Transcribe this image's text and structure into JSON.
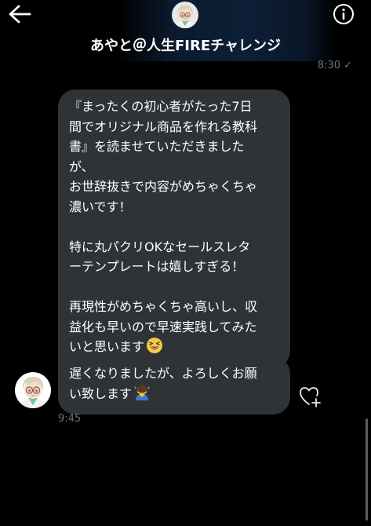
{
  "header": {
    "title": "あやと＠人生FIREチャレンジ",
    "back_icon": "arrow-left-icon",
    "info_icon": "info-icon"
  },
  "conversation": {
    "previous_time": "8:30 ✓",
    "messages": [
      {
        "lines": [
          "『まったくの初心者がたった7日",
          "間でオリジナル商品を作れる教科",
          "書』を読ませていただきました",
          "が、",
          "お世辞抜きで内容がめちゃくちゃ",
          "濃いです！",
          "",
          "特に丸パクリOKなセールスレタ",
          "ーテンプレートは嬉しすぎる！",
          "",
          "再現性がめちゃくちゃ高いし、収",
          "益化も早いので早速実践してみた",
          "いと思います"
        ],
        "emoji": "grinning-squinting-face-emoji"
      },
      {
        "lines": [
          "遅くなりましたが、よろしくお願",
          "い致します"
        ],
        "emoji": "bowing-person-emoji"
      }
    ],
    "time": "9:45",
    "like_icon": "heart-plus-icon"
  },
  "colors": {
    "background": "#000000",
    "bubble": "#2f3336",
    "timestamp": "#6f7378"
  }
}
